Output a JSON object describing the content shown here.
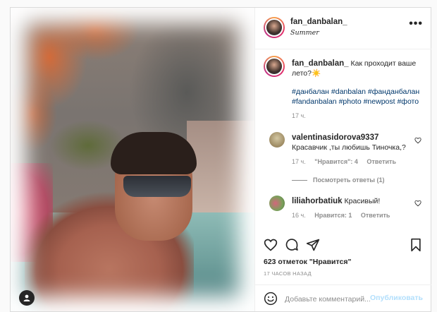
{
  "post": {
    "author": "fan_danbalan_",
    "location": "Summer",
    "caption_text": "Как проходит ваше лето?☀️",
    "hashtags_line1": "#данбалан #danbalan #фанданбалан",
    "hashtags_line2": "#fandanbalan #photo #newpost #фото",
    "caption_time": "17 ч."
  },
  "comments": [
    {
      "user": "valentinasidorova9337",
      "text": "Красавчик ,ты любишь Тиночка,?",
      "time": "17 ч.",
      "likes": "\"Нравится\": 4",
      "reply": "Ответить",
      "view_replies": "Посмотреть ответы (1)"
    },
    {
      "user": "liliahorbatiuk",
      "text": "Красивый!",
      "time": "16 ч.",
      "likes": "Нравится: 1",
      "reply": "Ответить"
    }
  ],
  "stats": {
    "likes": "623 отметок \"Нравится\"",
    "ago": "17 ЧАСОВ НАЗАД"
  },
  "add_comment": {
    "placeholder": "Добавьте комментарий...",
    "publish": "Опубликовать"
  },
  "icons": {
    "more": "more-horizontal-icon",
    "like": "heart-icon",
    "comment": "comment-bubble-icon",
    "share": "paper-plane-icon",
    "save": "bookmark-icon",
    "emoji": "smiley-icon",
    "tagged_user": "user-icon"
  },
  "colors": {
    "hashtag": "#00376b",
    "muted": "#8e8e8e",
    "publish_disabled": "#b2dffc"
  }
}
